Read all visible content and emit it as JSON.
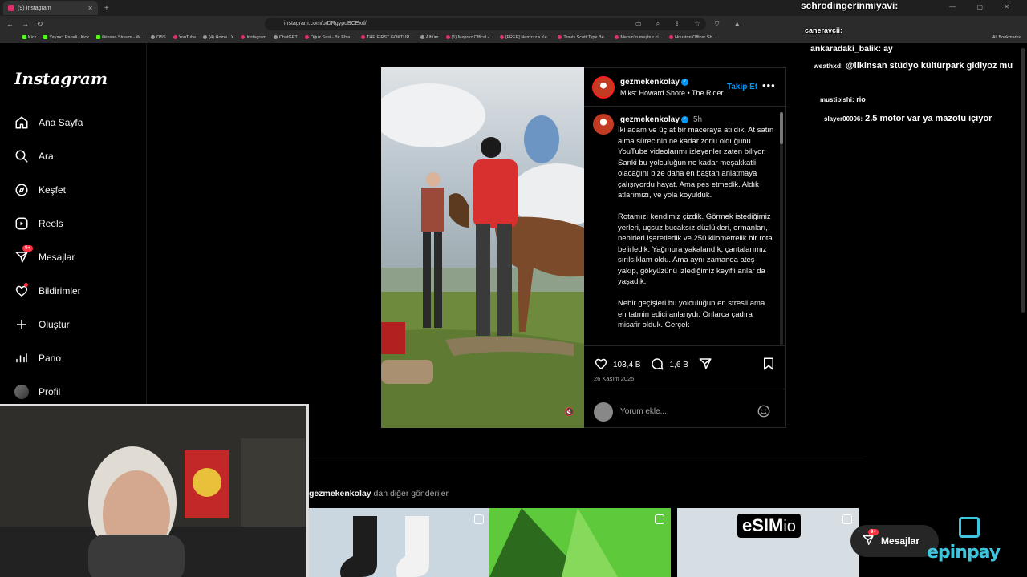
{
  "browser": {
    "tab_title": "(9) Instagram",
    "url": "instagram.com/p/DRgypuBCExd/",
    "bookmarks": [
      "Kick",
      "Yayıncı Paneli | Kick",
      "ilkinsan Stream - W...",
      "OBS",
      "YouTube",
      "(4) Home / X",
      "Instagram",
      "ChatGPT",
      "Oğuz Sasi - Bir Efsa...",
      "THE FIRST GOKTUR...",
      "Albüm",
      "(1) Mepraz Offical -...",
      "[FREE] Nemzzz x Ke...",
      "Travis Scott Type Be...",
      "Mersin'in meşhur ci...",
      "Houston Officer Sh..."
    ],
    "all_bookmarks": "All Bookmarks"
  },
  "sidebar": {
    "logo": "Instagram",
    "items": [
      {
        "label": "Ana Sayfa",
        "icon": "home-icon"
      },
      {
        "label": "Ara",
        "icon": "search-icon"
      },
      {
        "label": "Keşfet",
        "icon": "compass-icon"
      },
      {
        "label": "Reels",
        "icon": "reels-icon"
      },
      {
        "label": "Mesajlar",
        "icon": "messenger-icon",
        "badge": "9+"
      },
      {
        "label": "Bildirimler",
        "icon": "heart-icon"
      },
      {
        "label": "Oluştur",
        "icon": "plus-icon"
      },
      {
        "label": "Pano",
        "icon": "dashboard-icon"
      },
      {
        "label": "Profil",
        "icon": "profile-avatar"
      }
    ]
  },
  "post": {
    "username": "gezmekenkolay",
    "music": "Miks: Howard Shore • The Rider...",
    "follow_label": "Takip Et",
    "time": "5h",
    "caption": [
      "İki adam ve üç at bir maceraya atıldık. At satın alma sürecinin ne kadar zorlu olduğunu YouTube videolarımı izleyenler zaten biliyor. Sanki bu yolculuğun ne kadar meşakkatli olacağını bize daha en baştan anlatmaya çalışıyordu hayat. Ama pes etmedik. Aldık atlarımızı, ve yola koyulduk.",
      "Rotamızı kendimiz çizdik. Görmek istediğimiz yerleri, uçsuz bucaksız düzlükleri, ormanları, nehirleri işaretledik ve 250 kilometrelik bir rota belirledik. Yağmura yakalandık, çantalarımız sırılsıklam oldu. Ama aynı zamanda ateş yakıp, gökyüzünü izlediğimiz keyifli anlar da yaşadık.",
      "Nehir geçişleri bu yolculuğun en stresli ama en tatmin edici anlarıydı. Onlarca çadıra misafir olduk. Gerçek"
    ],
    "likes": "103,4 B",
    "comments": "1,6 B",
    "date": "26 Kasım 2025",
    "comment_placeholder": "Yorum ekle..."
  },
  "more_posts": {
    "username": "gezmekenkolay",
    "suffix": " dan diğer gönderiler",
    "tiles": [
      {
        "brand": ""
      },
      {
        "brand": ""
      },
      {
        "brand_main": "eSIM",
        "brand_sub": "io"
      }
    ]
  },
  "chat": [
    {
      "user": "schrodingerinmiyavi:",
      "text": ""
    },
    {
      "user": "caneravcii:",
      "text": ""
    },
    {
      "user": "ankaradaki_balik:",
      "text": "ay"
    },
    {
      "user": "weathxd:",
      "text": "@ilkinsan stüdyo kültürpark gidiyoz mu"
    },
    {
      "user": "mustibishi:",
      "text": "rio"
    },
    {
      "user": "slayer00006:",
      "text": "2.5 motor var ya mazotu içiyor"
    }
  ],
  "floating": {
    "messages_label": "Mesajlar",
    "badge": "9+",
    "sponsor": "epinpay"
  },
  "colors": {
    "accent": "#0095f6",
    "badge": "#ff3040",
    "background": "#000000"
  }
}
